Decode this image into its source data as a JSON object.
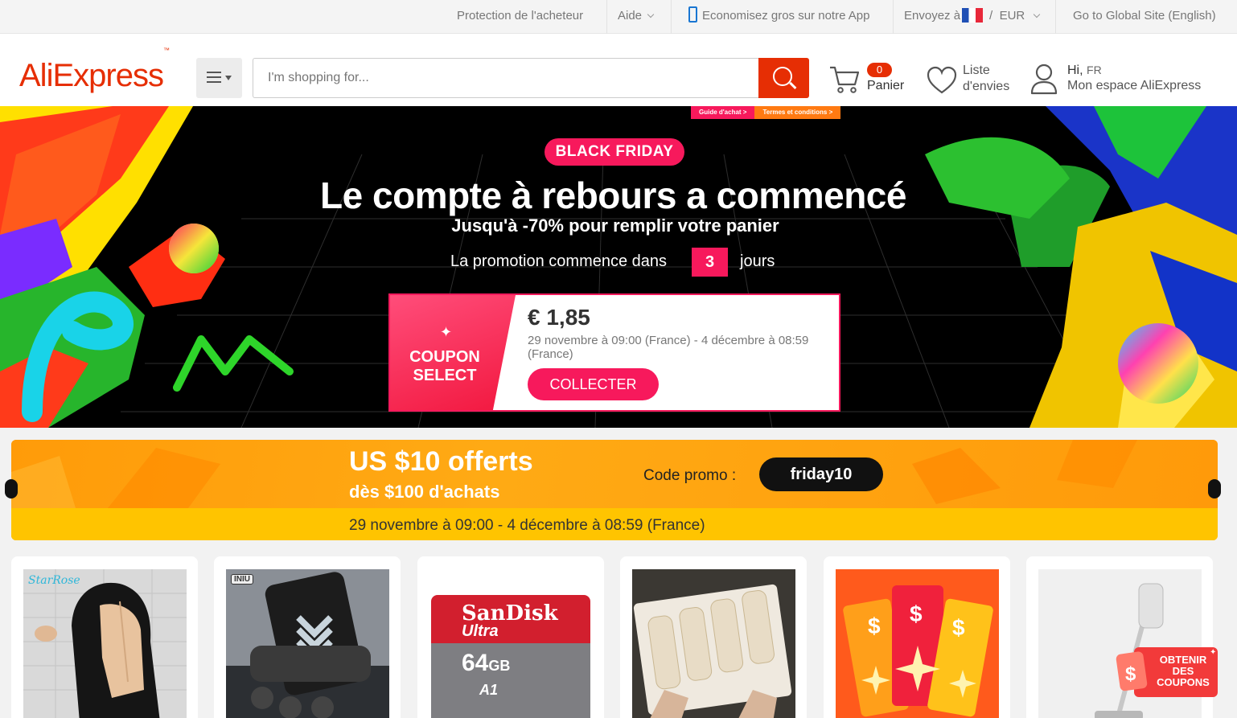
{
  "topbar": {
    "buyer_protection": "Protection de l'acheteur",
    "help": "Aide",
    "app": "Economisez gros sur notre App",
    "ship_to": "Envoyez à",
    "currency_sep": "/",
    "currency": "EUR",
    "global_site": "Go to Global Site (English)"
  },
  "header": {
    "logo": "AliExpress",
    "logo_tm": "™",
    "search_placeholder": "I'm shopping for...",
    "cart_count": "0",
    "cart_label": "Panier",
    "wishlist_line1": "Liste",
    "wishlist_line2": "d'envies",
    "greeting": "Hi,",
    "greeting_country": "FR",
    "account_label": "Mon espace AliExpress"
  },
  "banner": {
    "link_guide": "Guide d'achat  >",
    "link_terms": "Termes et conditions >",
    "badge": "BLACK FRIDAY",
    "title": "Le compte à rebours a commencé",
    "subtitle": "Jusqu'à -70% pour remplir votre panier",
    "promo_starts": "La promotion commence dans",
    "days_value": "3",
    "days_label": "jours",
    "coupon": {
      "label": "COUPON SELECT",
      "amount": "€ 1,85",
      "dates": "29 novembre à 09:00 (France) - 4 décembre à 08:59 (France)",
      "button": "COLLECTER"
    }
  },
  "promo_strip": {
    "headline": "US $10 offerts",
    "condition": "dès $100 d'achats",
    "code_label": "Code promo :",
    "code": "friday10",
    "dates": "29 novembre à 09:00 - 4 décembre à 08:59 (France)"
  },
  "products": [
    {
      "name": "lace-front-wig",
      "overlay_text": "StarRose"
    },
    {
      "name": "car-phone-holder",
      "overlay_text": "INIU"
    },
    {
      "name": "sandisk-microsd",
      "brand": "SanDisk",
      "line": "Ultra",
      "capacity": "64",
      "unit": "GB",
      "spec": "A1"
    },
    {
      "name": "pearl-hair-clips"
    },
    {
      "name": "coupon-tickets"
    },
    {
      "name": "vacuum-cleaner"
    }
  ],
  "floating_coupon": {
    "line1": "OBTENIR",
    "line2": "DES",
    "line3": "COUPONS"
  },
  "colors": {
    "brand": "#e62e04",
    "accent_pink": "#f7195c",
    "promo_orange": "#ff9f0a",
    "promo_yellow": "#ffc400"
  }
}
